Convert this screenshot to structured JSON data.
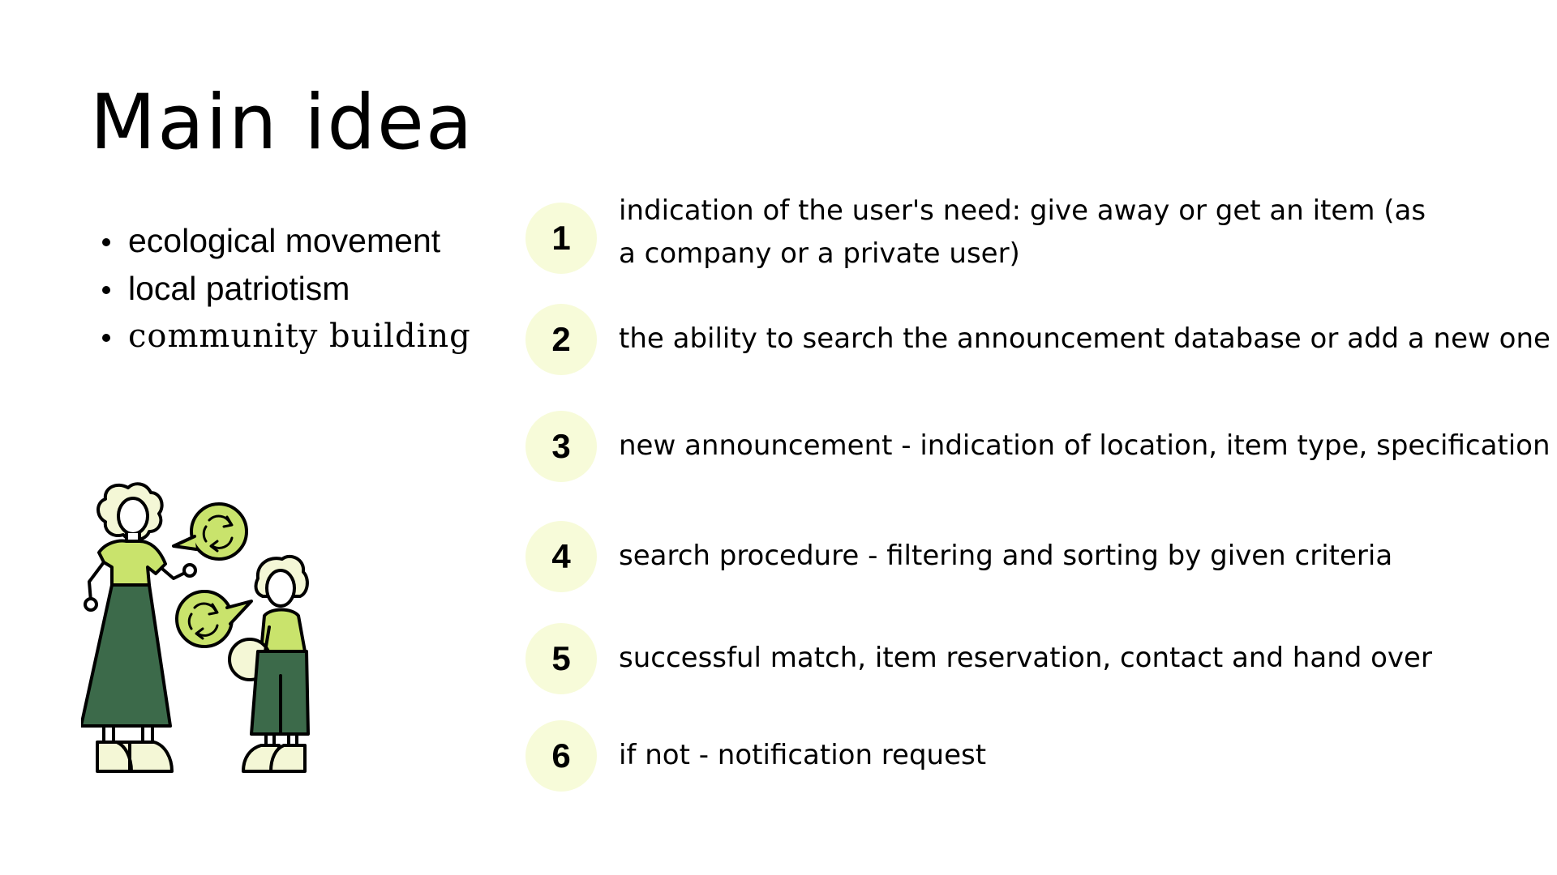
{
  "slide": {
    "title": "Main idea",
    "bullets": [
      "ecological movement",
      "local patriotism",
      "community building"
    ],
    "steps": [
      {
        "number": "1",
        "lines": [
          "indication of the user's need: give away or get an item (as",
          "a company or a private user)"
        ]
      },
      {
        "number": "2",
        "lines": [
          "the ability to search the announcement database or add a new one"
        ]
      },
      {
        "number": "3",
        "lines": [
          "new announcement - indication of location, item type, specification"
        ]
      },
      {
        "number": "4",
        "lines": [
          "search procedure - filtering and sorting by given criteria"
        ]
      },
      {
        "number": "5",
        "lines": [
          "successful match, item reservation, contact and hand over"
        ]
      },
      {
        "number": "6",
        "lines": [
          "if not - notification request"
        ]
      }
    ]
  },
  "colors": {
    "badge_fill": "#f7fbd9",
    "light_green": "#c9e36c",
    "dark_green": "#3c6a4a",
    "cream": "#f4f7d6",
    "ink": "#000000"
  },
  "icons": {
    "illustration": "mother-and-child-recycling-illustration"
  }
}
